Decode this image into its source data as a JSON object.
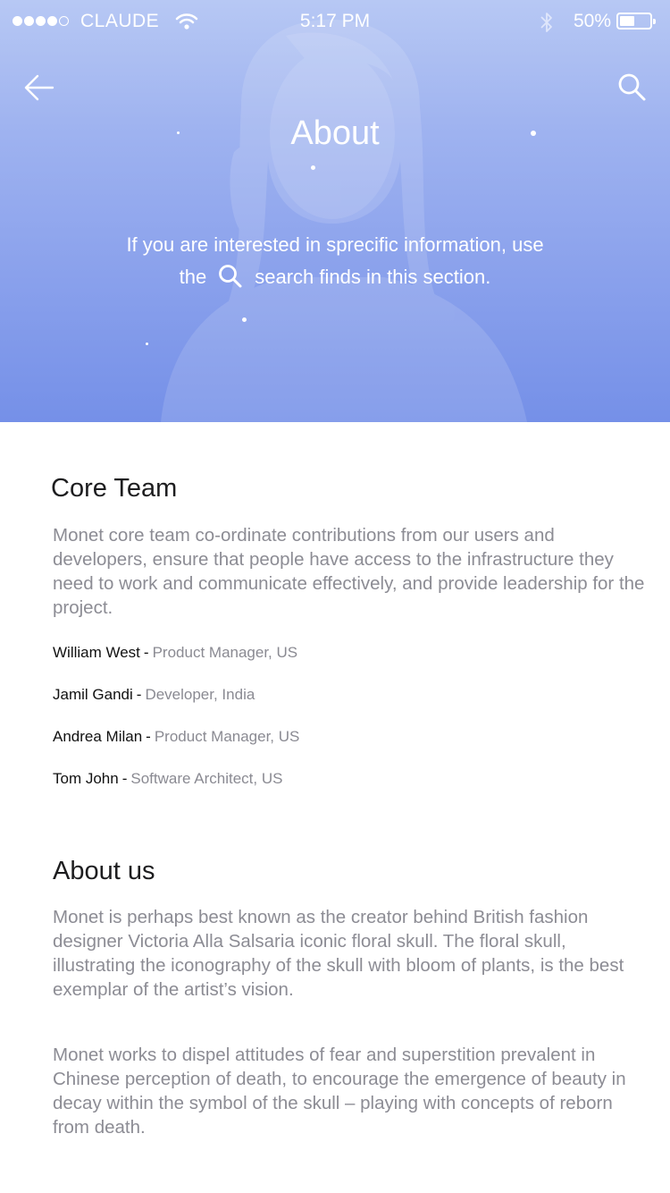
{
  "status_bar": {
    "carrier": "CLAUDE",
    "time": "5:17 PM",
    "battery_pct": "50%",
    "battery_level": 0.5
  },
  "header": {
    "title": "About",
    "description_line1": "If you are interested in sprecific information, use",
    "description_pre": "the",
    "description_post": "search finds in this section.",
    "back_icon": "arrow-left-icon",
    "search_icon": "search-icon"
  },
  "core_team": {
    "title": "Core Team",
    "description": "Monet core team co-ordinate contributions from our users and developers, ensure that people have access to the infrastructure they need to work and communicate effectively, and provide leadership for the project.",
    "members": [
      {
        "name": "William West",
        "role": "Product Manager, US"
      },
      {
        "name": "Jamil Gandi",
        "role": "Developer, India"
      },
      {
        "name": "Andrea Milan",
        "role": "Product Manager, US"
      },
      {
        "name": "Tom John",
        "role": "Software Architect, US"
      }
    ]
  },
  "about_us": {
    "title": "About us",
    "paragraph1": "Monet is perhaps best known as the creator behind British fashion designer Victoria Alla Salsaria iconic floral skull. The floral skull, illustrating the iconography of the skull with bloom of plants, is the best exemplar of the artist’s vision.",
    "paragraph2": "Monet works to dispel attitudes of fear and superstition prevalent in Chinese perception of death, to encourage the emergence of beauty in decay within the symbol of the skull – playing with concepts of reborn from death."
  },
  "separator": "-",
  "colors": {
    "hero_top": "#b7c8f4",
    "hero_bottom": "#7590e8",
    "body_text": "#8c8c94",
    "heading_text": "#1d1d1f"
  }
}
